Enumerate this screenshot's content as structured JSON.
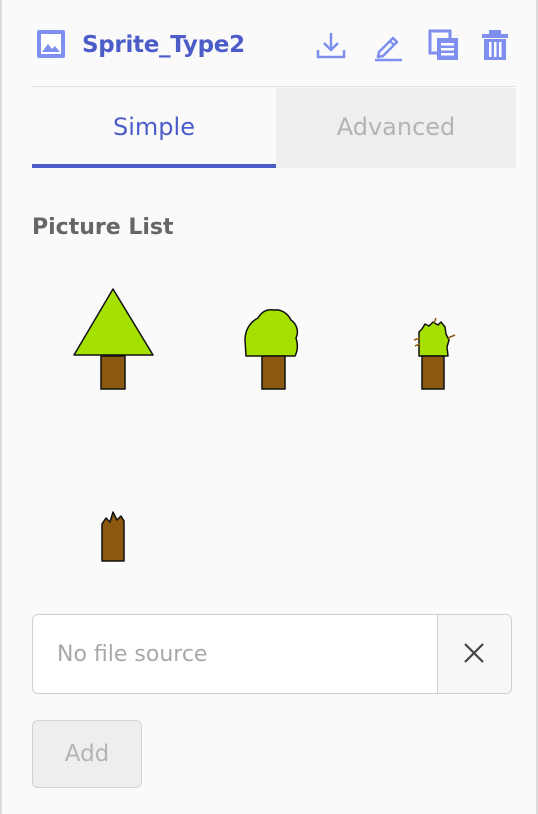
{
  "header": {
    "title": "Sprite_Type2",
    "icons": {
      "object": "image-icon",
      "download": "download-icon",
      "edit": "pencil-icon",
      "duplicate": "duplicate-icon",
      "delete": "trash-icon"
    }
  },
  "tabs": [
    {
      "label": "Simple",
      "active": true
    },
    {
      "label": "Advanced",
      "active": false
    }
  ],
  "picture_list": {
    "label": "Picture List",
    "items": [
      {
        "name": "tree-pine"
      },
      {
        "name": "tree-round"
      },
      {
        "name": "tree-damaged"
      },
      {
        "name": "tree-stump"
      }
    ]
  },
  "file_source": {
    "value": "",
    "placeholder": "No file source",
    "clear_icon": "close-icon"
  },
  "add_button": {
    "label": "Add",
    "enabled": false
  },
  "colors": {
    "accent": "#4c5dc9",
    "icon": "#7f8ff0",
    "leaf": "#a5e100",
    "trunk": "#8b5a10"
  }
}
